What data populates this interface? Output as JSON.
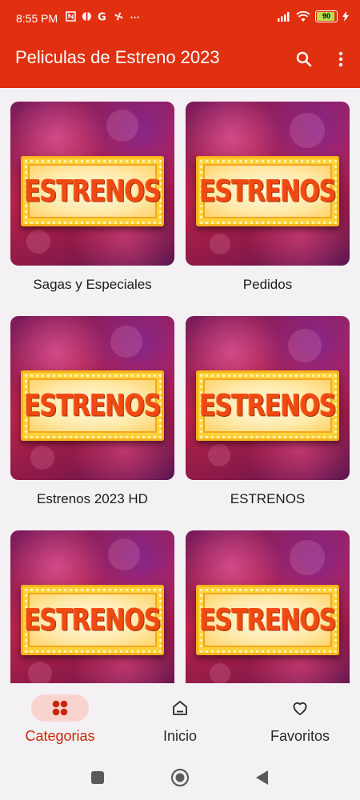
{
  "status_bar": {
    "time": "8:55 PM",
    "battery": "90",
    "icons": [
      "nfc-icon",
      "app-icon",
      "google-icon",
      "fan-icon",
      "more-dots-icon",
      "signal-icon",
      "wifi-icon",
      "battery-icon",
      "charging-icon"
    ]
  },
  "app_bar": {
    "title": "Peliculas de Estreno 2023",
    "background": "#e0300f"
  },
  "grid": {
    "items": [
      {
        "sign_text": "ESTRENOS",
        "label": "Sagas y Especiales"
      },
      {
        "sign_text": "ESTRENOS",
        "label": "Pedidos"
      },
      {
        "sign_text": "ESTRENOS",
        "label": "Estrenos 2023 HD"
      },
      {
        "sign_text": "ESTRENOS",
        "label": "ESTRENOS"
      },
      {
        "sign_text": "ESTRENOS",
        "label": ""
      },
      {
        "sign_text": "ESTRENOS",
        "label": ""
      }
    ]
  },
  "bottom_nav": {
    "items": [
      {
        "label": "Categorias",
        "icon": "categories-icon",
        "active": true
      },
      {
        "label": "Inicio",
        "icon": "home-icon",
        "active": false
      },
      {
        "label": "Favoritos",
        "icon": "heart-icon",
        "active": false
      }
    ],
    "active_color": "#c8260a"
  },
  "system_nav": {
    "buttons": [
      "recents-icon",
      "home-circle-icon",
      "back-icon"
    ]
  }
}
